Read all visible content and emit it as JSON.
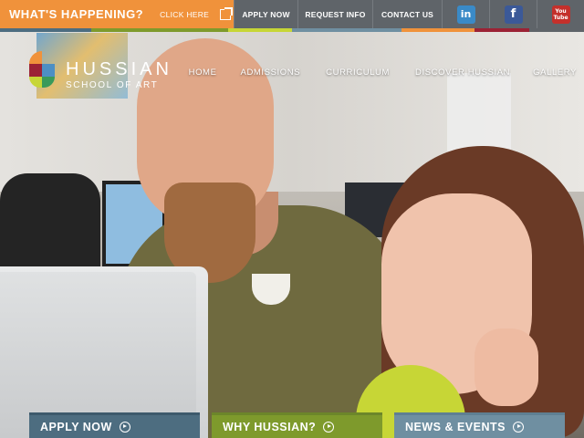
{
  "utility": {
    "happening_label": "WHAT'S HAPPENING?",
    "click_here": "CLICK HERE",
    "links": [
      "APPLY NOW",
      "REQUEST INFO",
      "CONTACT US"
    ],
    "social": [
      {
        "name": "linkedin-icon",
        "glyph": "in"
      },
      {
        "name": "facebook-icon",
        "glyph": "f"
      },
      {
        "name": "youtube-icon",
        "glyph_top": "You",
        "glyph_bottom": "Tube"
      }
    ]
  },
  "brand": {
    "name": "HUSSIAN",
    "tagline": "SCHOOL OF ART"
  },
  "nav": [
    "HOME",
    "ADMISSIONS",
    "CURRICULUM",
    "DISCOVER HUSSIAN",
    "GALLERY"
  ],
  "cta": [
    "APPLY NOW",
    "WHY HUSSIAN?",
    "NEWS & EVENTS"
  ],
  "colors": {
    "orange": "#f0923b",
    "util_bg": "#5f6469",
    "apply_blue": "#4d6d80",
    "why_green": "#7e9a2c",
    "news_blue": "#6f8fa1"
  }
}
